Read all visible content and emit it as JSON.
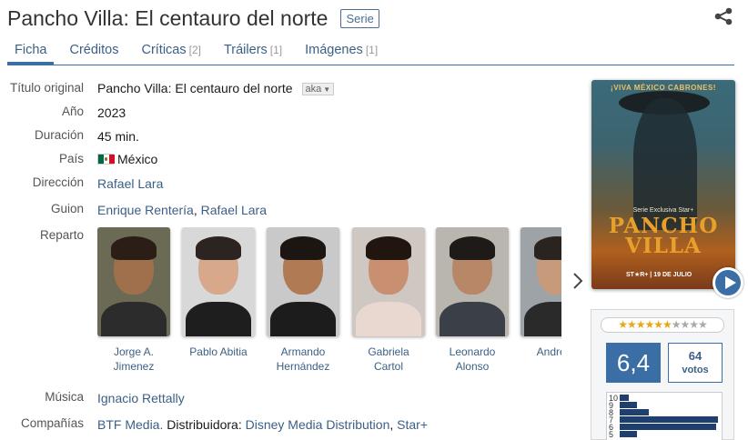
{
  "header": {
    "title": "Pancho Villa: El centauro del norte",
    "type_badge": "Serie",
    "share_icon": "share-icon"
  },
  "tabs": [
    {
      "label": "Ficha",
      "count": ""
    },
    {
      "label": "Créditos",
      "count": ""
    },
    {
      "label": "Críticas",
      "count": "[2]"
    },
    {
      "label": "Tráilers",
      "count": "[1]"
    },
    {
      "label": "Imágenes",
      "count": "[1]"
    }
  ],
  "details": {
    "original_title": {
      "label": "Título original",
      "value": "Pancho Villa: El centauro del norte",
      "aka": "aka"
    },
    "year": {
      "label": "Año",
      "value": "2023"
    },
    "duration": {
      "label": "Duración",
      "value": "45 min."
    },
    "country": {
      "label": "País",
      "value": "México",
      "flag_colors": [
        "#006847",
        "#ffffff",
        "#ce1126"
      ]
    },
    "direction": {
      "label": "Dirección",
      "value": "Rafael Lara"
    },
    "script": {
      "label": "Guion",
      "people": [
        "Enrique Rentería",
        "Rafael Lara"
      ],
      "separator": ","
    },
    "cast": {
      "label": "Reparto"
    },
    "music": {
      "label": "Música",
      "value": "Ignacio Rettally"
    },
    "companies": {
      "label": "Compañías",
      "company1": "BTF Media.",
      "distrib_label": "Distribuidora:",
      "distributor1": "Disney Media Distribution",
      "distributor2": "Star+",
      "separator": ","
    }
  },
  "cast": [
    {
      "name_line1": "Jorge A.",
      "name_line2": "Jimenez",
      "skin": "#a0704c",
      "hair": "#2a1e16",
      "shirt": "#2c2c2c",
      "bg": "#6b6b55"
    },
    {
      "name_line1": "Pablo Abitia",
      "name_line2": "",
      "skin": "#d8a88a",
      "hair": "#2b2420",
      "shirt": "#1e1e1e",
      "bg": "#d8d8d8"
    },
    {
      "name_line1": "Armando",
      "name_line2": "Hernández",
      "skin": "#b07a55",
      "hair": "#1b1612",
      "shirt": "#1c1c1c",
      "bg": "#c9c9c9"
    },
    {
      "name_line1": "Gabriela Cartol",
      "name_line2": "",
      "skin": "#c89070",
      "hair": "#20160f",
      "shirt": "#e8d8d0",
      "bg": "#cfc7c2"
    },
    {
      "name_line1": "Leonardo",
      "name_line2": "Alonso",
      "skin": "#b78767",
      "hair": "#1e1a17",
      "shirt": "#3a3f48",
      "bg": "#b9b6b0"
    },
    {
      "name_line1": "Andrés I",
      "name_line2": "",
      "skin": "#c79a7c",
      "hair": "#2a2420",
      "shirt": "#2a2a2a",
      "bg": "#9ea3a8"
    }
  ],
  "poster": {
    "tagline": "¡VIVA MÉXICO CABRONES!",
    "exclusive": "Serie Exclusiva Star+",
    "title_line1": "PANCHO",
    "title_line2": "VILLA",
    "footer": "ST★R+  |  19 DE JULIO"
  },
  "rating": {
    "stars_filled": 6.4,
    "stars_total": 10,
    "score": "6,4",
    "votes_count": "64",
    "votes_label": "votos",
    "histogram": [
      {
        "label": "10",
        "pct": 9
      },
      {
        "label": "9",
        "pct": 18
      },
      {
        "label": "8",
        "pct": 30
      },
      {
        "label": "7",
        "pct": 100
      },
      {
        "label": "6",
        "pct": 98
      },
      {
        "label": "5",
        "pct": 18
      }
    ]
  }
}
